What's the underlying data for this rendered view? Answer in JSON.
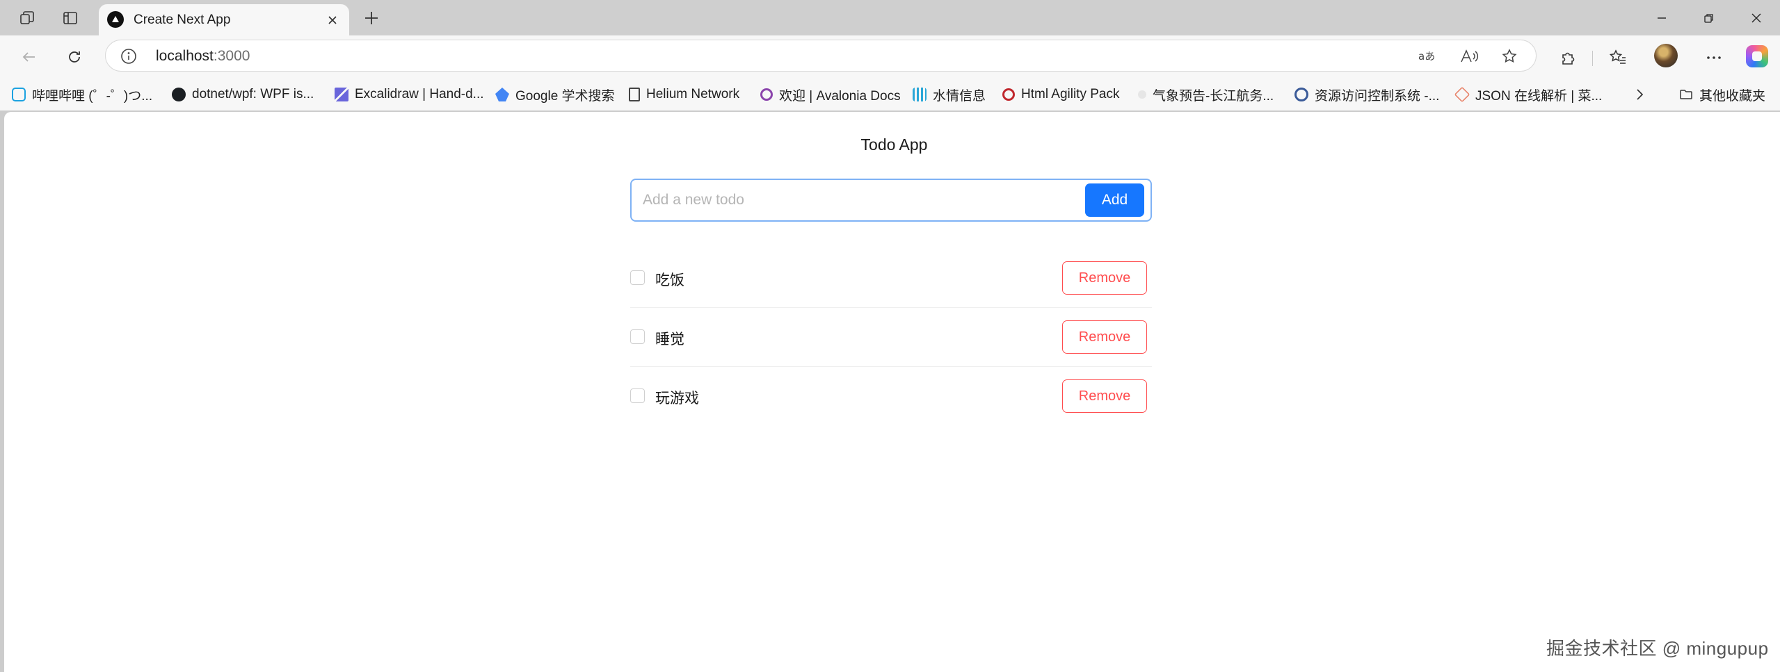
{
  "browser": {
    "tab": {
      "title": "Create Next App"
    },
    "url": {
      "host": "localhost",
      "port": ":3000"
    },
    "bookmarks": [
      {
        "label": "哔哩哔哩 (゜-゜)つ...",
        "icon": "bilibili-icon"
      },
      {
        "label": "dotnet/wpf: WPF is...",
        "icon": "github-icon"
      },
      {
        "label": "Excalidraw | Hand-d...",
        "icon": "excalidraw-icon"
      },
      {
        "label": "Google 学术搜索",
        "icon": "google-scholar-icon"
      },
      {
        "label": "Helium Network",
        "icon": "page-icon"
      },
      {
        "label": "欢迎 | Avalonia Docs",
        "icon": "avalonia-icon"
      },
      {
        "label": "水情信息",
        "icon": "water-info-icon"
      },
      {
        "label": "Html Agility Pack",
        "icon": "htmlagilitypack-icon"
      },
      {
        "label": "气象预告-长江航务...",
        "icon": "weather-icon"
      },
      {
        "label": "资源访问控制系统 -...",
        "icon": "access-control-icon"
      },
      {
        "label": "JSON 在线解析 | 菜...",
        "icon": "runoob-icon"
      }
    ],
    "other_bookmarks": "其他收藏夹"
  },
  "app": {
    "title": "Todo App",
    "input_placeholder": "Add a new todo",
    "add_label": "Add",
    "remove_label": "Remove",
    "todos": [
      {
        "text": "吃饭",
        "done": false
      },
      {
        "text": "睡觉",
        "done": false
      },
      {
        "text": "玩游戏",
        "done": false
      }
    ]
  },
  "watermark": "掘金技术社区 @ mingupup",
  "colors": {
    "primary": "#1677ff",
    "danger": "#ff4d4f",
    "focus_border": "#7fb2f5"
  }
}
